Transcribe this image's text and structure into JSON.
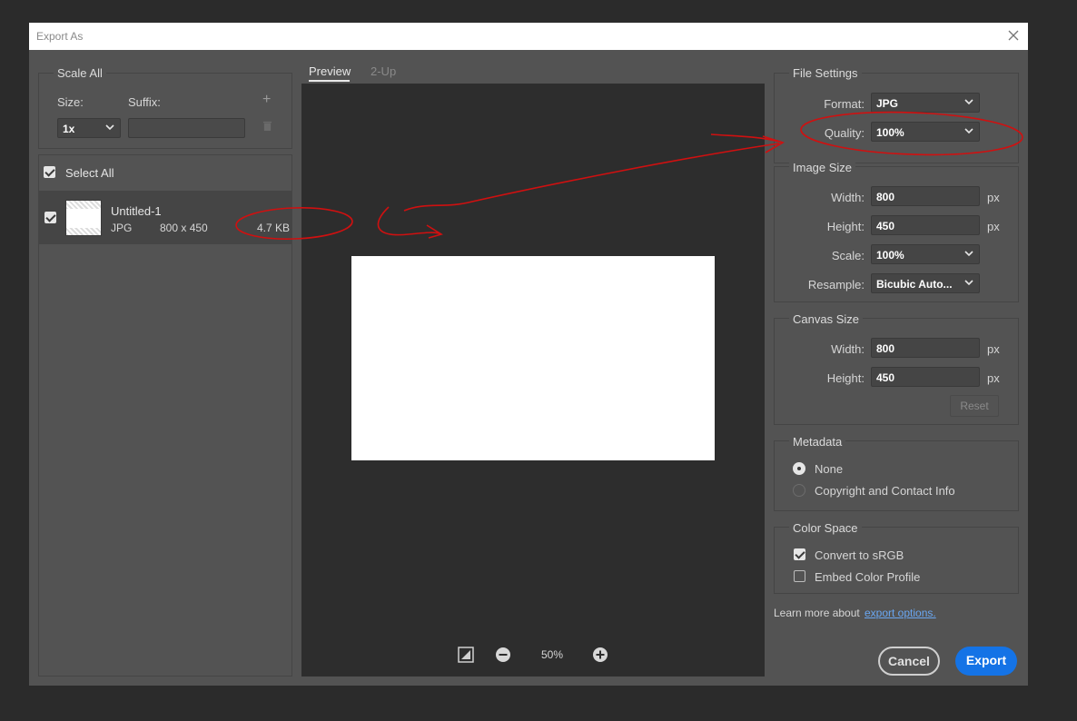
{
  "dialog": {
    "title": "Export As"
  },
  "scale_all": {
    "title": "Scale All",
    "size_label": "Size:",
    "suffix_label": "Suffix:",
    "size_value": "1x",
    "suffix_value": ""
  },
  "asset_list": {
    "select_all_label": "Select All",
    "items": [
      {
        "name": "Untitled-1",
        "format": "JPG",
        "dimensions": "800 x 450",
        "file_size": "4.7 KB"
      }
    ]
  },
  "preview": {
    "tabs": [
      {
        "label": "Preview"
      },
      {
        "label": "2-Up"
      }
    ],
    "zoom": "50%"
  },
  "file_settings": {
    "title": "File Settings",
    "format_label": "Format:",
    "format_value": "JPG",
    "quality_label": "Quality:",
    "quality_value": "100%"
  },
  "image_size": {
    "title": "Image Size",
    "width_label": "Width:",
    "width_value": "800",
    "height_label": "Height:",
    "height_value": "450",
    "unit": "px",
    "scale_label": "Scale:",
    "scale_value": "100%",
    "resample_label": "Resample:",
    "resample_value": "Bicubic Auto..."
  },
  "canvas_size": {
    "title": "Canvas Size",
    "width_label": "Width:",
    "width_value": "800",
    "height_label": "Height:",
    "height_value": "450",
    "unit": "px",
    "reset_label": "Reset"
  },
  "metadata": {
    "title": "Metadata",
    "options": [
      {
        "label": "None",
        "selected": true
      },
      {
        "label": "Copyright and Contact Info",
        "selected": false
      }
    ]
  },
  "color_space": {
    "title": "Color Space",
    "convert_label": "Convert to sRGB",
    "convert_checked": true,
    "embed_label": "Embed Color Profile",
    "embed_checked": false
  },
  "footer": {
    "learn_more_text": "Learn more about",
    "learn_more_link": "export options.",
    "cancel_label": "Cancel",
    "export_label": "Export"
  },
  "colors": {
    "accent": "#1473e6",
    "annotation": "#d01010",
    "dialog_bg": "#535353",
    "preview_bg": "#2d2d2d"
  }
}
